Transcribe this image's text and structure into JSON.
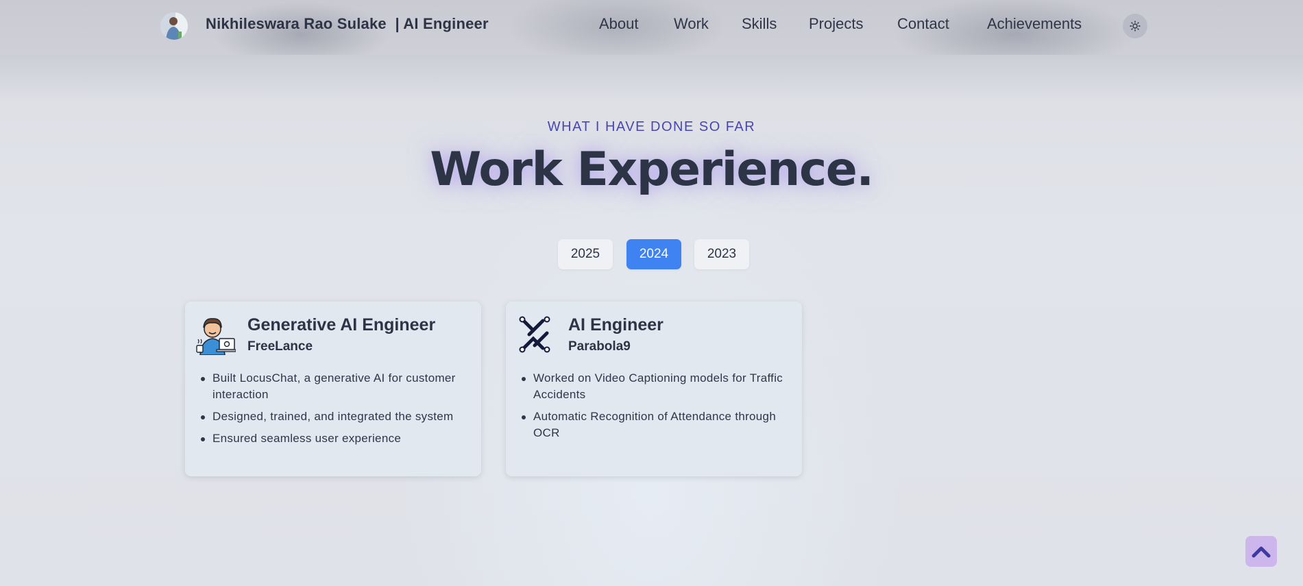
{
  "header": {
    "brand": "Nikhileswara Rao Sulake  | AI Engineer",
    "nav": [
      {
        "label": "About"
      },
      {
        "label": "Work"
      },
      {
        "label": "Skills"
      },
      {
        "label": "Projects"
      },
      {
        "label": "Contact"
      },
      {
        "label": "Achievements"
      }
    ],
    "theme_icon": "sun-icon"
  },
  "section": {
    "eyebrow": "WHAT I HAVE DONE SO FAR",
    "title": "Work Experience."
  },
  "years": {
    "tabs": [
      {
        "label": "2025"
      },
      {
        "label": "2024"
      },
      {
        "label": "2023"
      }
    ],
    "selected": "2024"
  },
  "experiences": [
    {
      "role": "Generative AI Engineer",
      "company": "FreeLance",
      "icon": "freelancer-icon",
      "points": [
        "Built LocusChat, a generative AI for customer interaction",
        "Designed, trained, and integrated the system",
        "Ensured seamless user experience"
      ]
    },
    {
      "role": "AI Engineer",
      "company": "Parabola9",
      "icon": "parabola9-logo-icon",
      "points": [
        "Worked on Video Captioning models for Traffic Accidents",
        "Automatic Recognition of Attendance through OCR"
      ]
    }
  ],
  "colors": {
    "accent": "#3f83f2",
    "eyebrow": "#4a46b0",
    "text": "#2d3446",
    "scroll_button": "#cdb6ec"
  },
  "scroll_top_icon": "chevron-up-icon"
}
